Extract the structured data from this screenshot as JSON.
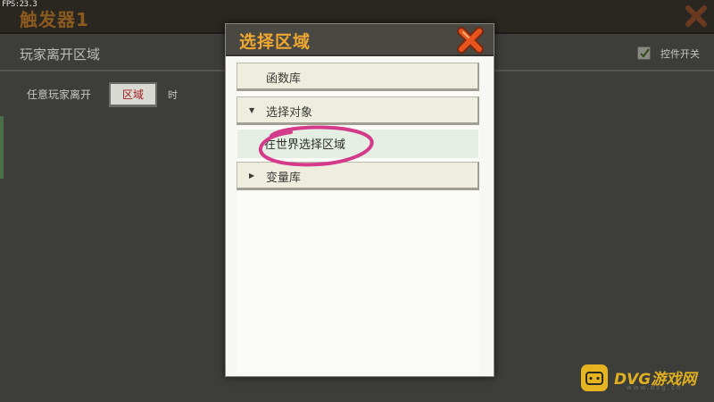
{
  "hud": {
    "fps": "FPS:23.3"
  },
  "background_window": {
    "title": "触发器1",
    "section_title": "玩家离开区域",
    "checkbox_label": "控件开关",
    "checkbox_checked": true,
    "row_label": "任意玩家离开",
    "region_button_label": "区域",
    "row_suffix": "时"
  },
  "modal": {
    "title": "选择区域",
    "items": [
      {
        "label": "函数库",
        "expanded": null
      },
      {
        "label": "选择对象",
        "expanded": true
      },
      {
        "label": "变量库",
        "expanded": false
      }
    ],
    "subitem_label": "在世界选择区域"
  },
  "colors": {
    "accent_title": "#f0a830",
    "close_red": "#d8401c",
    "annotation_magenta": "#d43a8a",
    "region_text_red": "#a52020"
  },
  "icons": {
    "modal_close": "close-x-icon",
    "expanded_arrow": "triangle-down-icon",
    "collapsed_arrow": "triangle-right-icon",
    "check": "check-icon"
  },
  "watermark": {
    "brand": "DVG游戏网",
    "sub": "www.dvg.cn"
  }
}
